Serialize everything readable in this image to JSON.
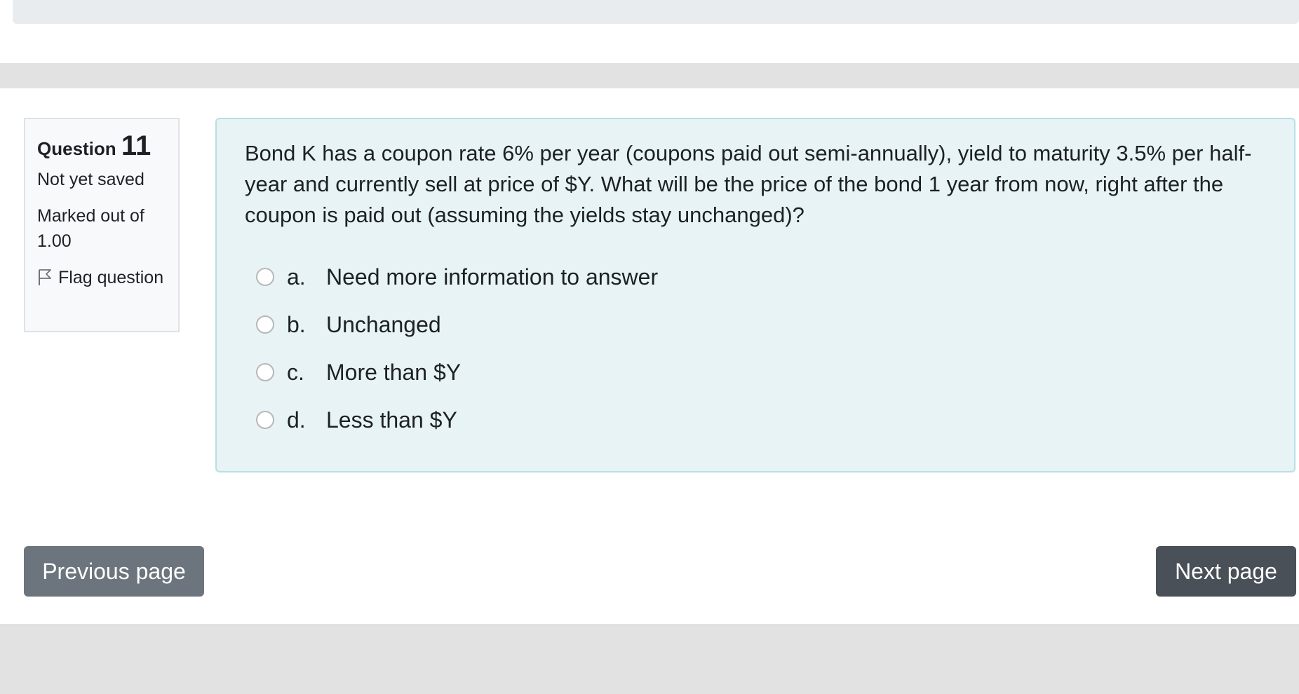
{
  "question_info": {
    "title_label": "Question",
    "number": "11",
    "state": "Not yet saved",
    "grade": "Marked out of 1.00",
    "flag_label": "Flag question"
  },
  "question": {
    "text": "Bond K has a coupon rate 6% per year (coupons paid out semi-annually), yield to maturity 3.5% per half-year and currently sell at price of $Y. What will be the price of the bond 1 year from now, right after the coupon is paid out (assuming the yields stay unchanged)?",
    "answers": [
      {
        "letter": "a.",
        "text": "Need more information to answer"
      },
      {
        "letter": "b.",
        "text": "Unchanged"
      },
      {
        "letter": "c.",
        "text": "More than $Y"
      },
      {
        "letter": "d.",
        "text": "Less than $Y"
      }
    ]
  },
  "navigation": {
    "previous_label": "Previous page",
    "next_label": "Next page"
  },
  "colors": {
    "content_bg": "#e7f3f5",
    "content_border": "#b8dfe6",
    "prev_button": "#6c757d",
    "next_button": "#495057",
    "band": "#e2e2e2"
  }
}
